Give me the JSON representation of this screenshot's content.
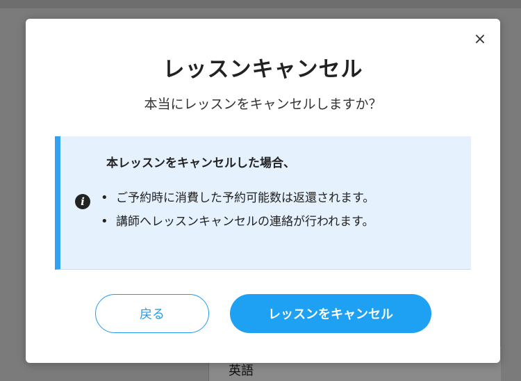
{
  "background": {
    "visible_text": "英語"
  },
  "modal": {
    "close_glyph": "×",
    "title": "レッスンキャンセル",
    "subtitle": "本当にレッスンをキャンセルしますか？",
    "info": {
      "heading": "本レッスンをキャンセルした場合、",
      "icon": "info-icon",
      "items": [
        "ご予約時に消費した予約可能数は返還されます。",
        "講師へレッスンキャンセルの連絡が行われます。"
      ]
    },
    "buttons": {
      "back_label": "戻る",
      "cancel_label": "レッスンをキャンセル"
    }
  },
  "colors": {
    "accent": "#1ea0f3",
    "info_background": "#e5f1fd",
    "info_border": "#33a0f0",
    "overlay": "#7b7b7b"
  }
}
